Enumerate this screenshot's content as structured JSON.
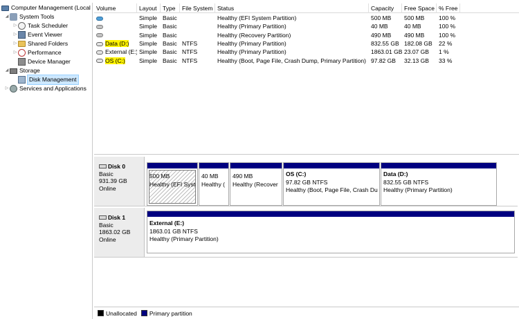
{
  "tree": {
    "root": "Computer Management (Local",
    "system_tools": "System Tools",
    "task_scheduler": "Task Scheduler",
    "event_viewer": "Event Viewer",
    "shared_folders": "Shared Folders",
    "performance": "Performance",
    "device_manager": "Device Manager",
    "storage": "Storage",
    "disk_management": "Disk Management",
    "services": "Services and Applications"
  },
  "list": {
    "columns": [
      "Volume",
      "Layout",
      "Type",
      "File System",
      "Status",
      "Capacity",
      "Free Space",
      "% Free"
    ],
    "rows": [
      {
        "icon": "volume-icon",
        "volume": "",
        "layout": "Simple",
        "type": "Basic",
        "fs": "",
        "status": "Healthy (EFI System Partition)",
        "capacity": "500 MB",
        "free": "500 MB",
        "pct": "100 %",
        "highlight": false
      },
      {
        "icon": "volume-icon",
        "volume": "",
        "layout": "Simple",
        "type": "Basic",
        "fs": "",
        "status": "Healthy (Primary Partition)",
        "capacity": "40 MB",
        "free": "40 MB",
        "pct": "100 %",
        "highlight": false
      },
      {
        "icon": "volume-icon",
        "volume": "",
        "layout": "Simple",
        "type": "Basic",
        "fs": "",
        "status": "Healthy (Recovery Partition)",
        "capacity": "490 MB",
        "free": "490 MB",
        "pct": "100 %",
        "highlight": false
      },
      {
        "icon": "drive-icon",
        "volume": "Data (D:)",
        "layout": "Simple",
        "type": "Basic",
        "fs": "NTFS",
        "status": "Healthy (Primary Partition)",
        "capacity": "832.55 GB",
        "free": "182.08 GB",
        "pct": "22 %",
        "highlight": true
      },
      {
        "icon": "drive-icon",
        "volume": "External (E:)",
        "layout": "Simple",
        "type": "Basic",
        "fs": "NTFS",
        "status": "Healthy (Primary Partition)",
        "capacity": "1863.01 GB",
        "free": "23.07 GB",
        "pct": "1 %",
        "highlight": false
      },
      {
        "icon": "drive-icon",
        "volume": "OS (C:)",
        "layout": "Simple",
        "type": "Basic",
        "fs": "NTFS",
        "status": "Healthy (Boot, Page File, Crash Dump, Primary Partition)",
        "capacity": "97.82 GB",
        "free": "32.13 GB",
        "pct": "33 %",
        "highlight": true
      }
    ]
  },
  "disks": [
    {
      "name": "Disk 0",
      "type": "Basic",
      "size": "931.39 GB",
      "status": "Online",
      "partitions": [
        {
          "name": "",
          "size": "500 MB",
          "status": "Healthy (EFI Syste",
          "hatched": true
        },
        {
          "name": "",
          "size": "40 MB",
          "status": "Healthy (",
          "hatched": false
        },
        {
          "name": "",
          "size": "490 MB",
          "status": "Healthy (Recover",
          "hatched": false
        },
        {
          "name": "OS  (C:)",
          "size": "97.82 GB NTFS",
          "status": "Healthy (Boot, Page File, Crash Du",
          "hatched": false
        },
        {
          "name": "Data  (D:)",
          "size": "832.55 GB NTFS",
          "status": "Healthy (Primary Partition)",
          "hatched": false
        }
      ]
    },
    {
      "name": "Disk 1",
      "type": "Basic",
      "size": "1863.02 GB",
      "status": "Online",
      "partitions": [
        {
          "name": "External  (E:)",
          "size": "1863.01 GB NTFS",
          "status": "Healthy (Primary Partition)",
          "hatched": false
        }
      ]
    }
  ],
  "legend": {
    "unallocated": "Unallocated",
    "primary": "Primary partition",
    "unallocated_color": "#000000",
    "primary_color": "#000080"
  },
  "colors": {
    "highlight": "#fff300",
    "partition_bar": "#000080",
    "selection": "#cde8ff"
  }
}
